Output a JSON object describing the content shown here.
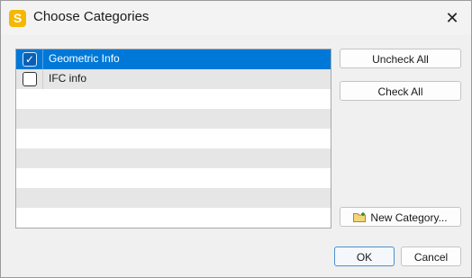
{
  "window": {
    "title": "Choose Categories",
    "app_icon_letter": "S",
    "close_glyph": "✕"
  },
  "list": {
    "items": [
      {
        "label": "Geometric Info",
        "checked": true,
        "selected": true
      },
      {
        "label": "IFC info",
        "checked": false,
        "selected": false
      }
    ],
    "check_glyph": "✓"
  },
  "buttons": {
    "uncheck_all": "Uncheck All",
    "check_all": "Check All",
    "new_category": "New Category...",
    "ok": "OK",
    "cancel": "Cancel"
  },
  "colors": {
    "selection": "#0078d7",
    "app_icon": "#f5b700"
  }
}
